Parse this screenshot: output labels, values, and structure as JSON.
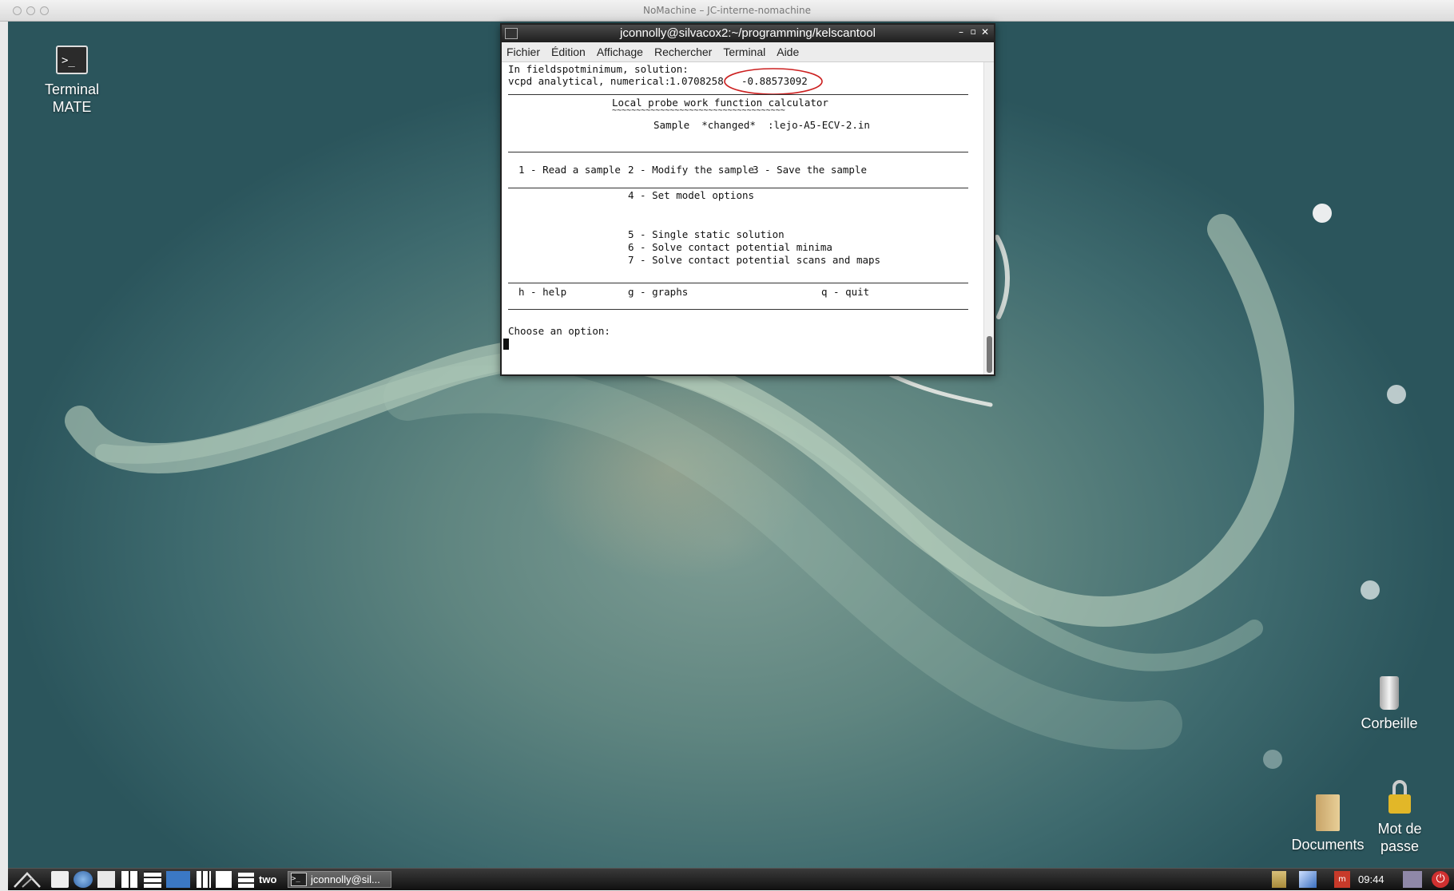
{
  "mac_window": {
    "title": "NoMachine – JC-interne-nomachine"
  },
  "desktop_icons": {
    "terminal": {
      "line1": "Terminal",
      "line2": "MATE"
    },
    "trash": {
      "label": "Corbeille"
    },
    "documents": {
      "label": "Documents"
    },
    "password": {
      "line1": "Mot de",
      "line2": "passe"
    }
  },
  "terminal": {
    "title": "jconnolly@silvacox2:~/programming/kelscantool",
    "menu": [
      "Fichier",
      "Édition",
      "Affichage",
      "Rechercher",
      "Terminal",
      "Aide"
    ],
    "lines": {
      "l1": "In fieldspotminimum, solution:",
      "l2a": "vcpd analytical, numerical:",
      "l2b": "1.0708258",
      "l2c": "-0.88573092",
      "heading": "Local probe work function calculator",
      "underline": "~~~~~~~~~~~~~~~~~~~~~~~~~~~~~~~~~~~~",
      "sample": "Sample  *changed*  :lejo-A5-ECV-2.in",
      "opt1": "1 - Read a sample",
      "opt2": "2 - Modify the sample",
      "opt3": "3 - Save the sample",
      "opt4": "4 - Set model options",
      "opt5": "5 - Single static solution",
      "opt6": "6 - Solve contact potential minima",
      "opt7": "7 - Solve contact potential scans and maps",
      "help": "h - help",
      "graphs": "g - graphs",
      "quit": "q - quit",
      "prompt": "Choose an option:"
    }
  },
  "taskbar": {
    "workspace_label": "two",
    "task_label": "jconnolly@sil...",
    "clock": "09:44"
  },
  "colors": {
    "highlight_circle": "#cc2020",
    "power": "#d03030"
  }
}
